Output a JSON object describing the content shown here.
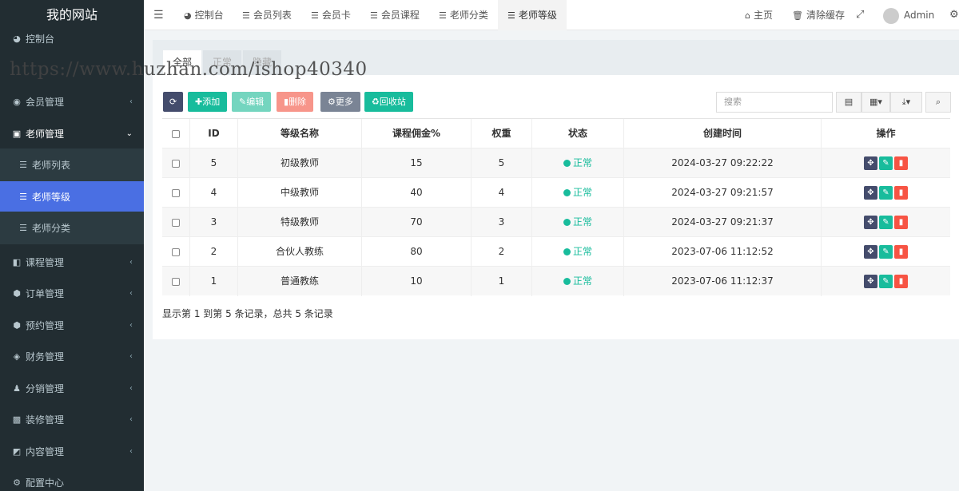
{
  "site": {
    "title": "我的网站"
  },
  "sidebar": {
    "items": [
      {
        "label": "控制台",
        "icon": "dashboard-icon",
        "glyph": "◕"
      },
      {
        "label": "会员管理",
        "icon": "user-circle-icon",
        "glyph": "◉"
      },
      {
        "label": "老师管理",
        "icon": "teacher-icon",
        "glyph": "▣"
      },
      {
        "label": "老师列表",
        "icon": "list-icon",
        "glyph": "☰"
      },
      {
        "label": "老师等级",
        "icon": "list-icon",
        "glyph": "☰"
      },
      {
        "label": "老师分类",
        "icon": "list-icon",
        "glyph": "☰"
      },
      {
        "label": "课程管理",
        "icon": "course-icon",
        "glyph": "◧"
      },
      {
        "label": "订单管理",
        "icon": "cube-icon",
        "glyph": "⬢"
      },
      {
        "label": "预约管理",
        "icon": "cube-icon",
        "glyph": "⬢"
      },
      {
        "label": "财务管理",
        "icon": "diamond-icon",
        "glyph": "◈"
      },
      {
        "label": "分销管理",
        "icon": "users-icon",
        "glyph": "♟"
      },
      {
        "label": "装修管理",
        "icon": "image-icon",
        "glyph": "▩"
      },
      {
        "label": "内容管理",
        "icon": "edit-icon",
        "glyph": "◩"
      },
      {
        "label": "配置中心",
        "icon": "cog-icon",
        "glyph": "⚙"
      }
    ]
  },
  "header": {
    "tabs": [
      {
        "label": "控制台",
        "icon": "dashboard-icon"
      },
      {
        "label": "会员列表",
        "icon": "list-icon"
      },
      {
        "label": "会员卡",
        "icon": "list-icon"
      },
      {
        "label": "会员课程",
        "icon": "list-icon"
      },
      {
        "label": "老师分类",
        "icon": "list-icon"
      },
      {
        "label": "老师等级",
        "icon": "list-icon"
      }
    ],
    "home": "主页",
    "clear_cache": "清除缓存",
    "user": "Admin"
  },
  "watermark": "https://www.huzhan.com/ishop40340",
  "filter_tabs": [
    "全部",
    "正常",
    "隐藏"
  ],
  "toolbar": {
    "add": "添加",
    "edit": "编辑",
    "delete": "删除",
    "more": "更多",
    "recycle": "回收站",
    "search_placeholder": "搜索"
  },
  "table": {
    "columns": [
      "ID",
      "等级名称",
      "课程佣金%",
      "权重",
      "状态",
      "创建时间",
      "操作"
    ],
    "rows": [
      {
        "id": "5",
        "name": "初级教师",
        "commission": "15",
        "weight": "5",
        "status": "正常",
        "created": "2024-03-27 09:22:22"
      },
      {
        "id": "4",
        "name": "中级教师",
        "commission": "40",
        "weight": "4",
        "status": "正常",
        "created": "2024-03-27 09:21:57"
      },
      {
        "id": "3",
        "name": "特级教师",
        "commission": "70",
        "weight": "3",
        "status": "正常",
        "created": "2024-03-27 09:21:37"
      },
      {
        "id": "2",
        "name": "合伙人教练",
        "commission": "80",
        "weight": "2",
        "status": "正常",
        "created": "2023-07-06 11:12:52"
      },
      {
        "id": "1",
        "name": "普通教练",
        "commission": "10",
        "weight": "1",
        "status": "正常",
        "created": "2023-07-06 11:12:37"
      }
    ]
  },
  "pagination": {
    "summary": "显示第 1 到第 5 条记录，总共 5 条记录"
  },
  "colors": {
    "sidebar_bg": "#222d32",
    "active": "#4a6fe3",
    "success": "#18bc9c",
    "danger": "#f75444"
  }
}
